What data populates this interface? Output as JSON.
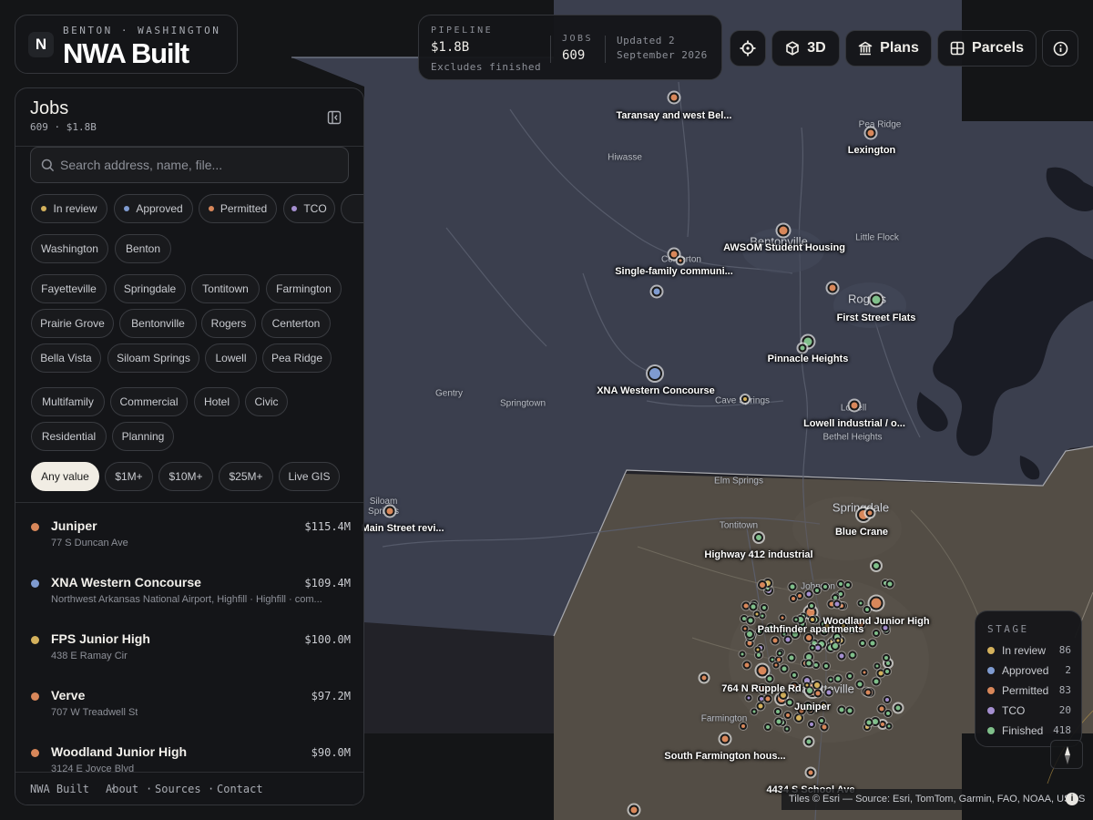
{
  "brand": {
    "logo_letter": "N",
    "location": "BENTON · WASHINGTON",
    "name": "NWA Built"
  },
  "pipeline": {
    "pipeline_label": "PIPELINE",
    "pipeline_value": "$1.8B",
    "pipeline_sub": "Excludes finished",
    "jobs_label": "JOBS",
    "jobs_value": "609",
    "updated_line1": "Updated 2",
    "updated_line2": "September 2026"
  },
  "toolbar": {
    "locate_icon": "crosshair-icon",
    "view3d_label": "3D",
    "view3d_icon": "cube-icon",
    "plans_label": "Plans",
    "plans_icon": "building-columns-icon",
    "parcels_label": "Parcels",
    "parcels_icon": "grid-icon",
    "info_icon": "info-icon"
  },
  "sidebar": {
    "title": "Jobs",
    "stats": "609 · $1.8B",
    "search_placeholder": "Search address, name, file...",
    "stage_filters": [
      {
        "label": "In review",
        "color": "#d4b15c"
      },
      {
        "label": "Approved",
        "color": "#7f9bd0"
      },
      {
        "label": "Permitted",
        "color": "#d8875a"
      },
      {
        "label": "TCO",
        "color": "#a58fd0"
      }
    ],
    "county_filters": [
      "Washington",
      "Benton"
    ],
    "city_filters": [
      "Fayetteville",
      "Springdale",
      "Tontitown",
      "Farmington",
      "Prairie Grove",
      "Bentonville",
      "Rogers",
      "Centerton",
      "Bella Vista",
      "Siloam Springs",
      "Lowell",
      "Pea Ridge"
    ],
    "type_filters": [
      "Multifamily",
      "Commercial",
      "Hotel",
      "Civic",
      "Residential",
      "Planning"
    ],
    "value_filters": [
      "Any value",
      "$1M+",
      "$10M+",
      "$25M+",
      "Live GIS"
    ],
    "jobs": [
      {
        "name": "Juniper",
        "value": "$115.4M",
        "address": "77 S Duncan Ave",
        "color": "#d8875a"
      },
      {
        "name": "XNA Western Concourse",
        "value": "$109.4M",
        "address": "Northwest Arkansas National Airport, Highfill · Highfill · com...",
        "color": "#7f9bd0"
      },
      {
        "name": "FPS Junior High",
        "value": "$100.0M",
        "address": "438 E Ramay Cir",
        "color": "#d4b15c"
      },
      {
        "name": "Verve",
        "value": "$97.2M",
        "address": "707 W Treadwell St",
        "color": "#d8875a"
      },
      {
        "name": "Woodland Junior High",
        "value": "$90.0M",
        "address": "3124 E Joyce Blvd",
        "color": "#d8875a"
      }
    ],
    "footer": [
      "NWA Built",
      "About",
      "Sources",
      "Contact"
    ]
  },
  "legend": {
    "title": "STAGE",
    "items": [
      {
        "label": "In review",
        "count": "86",
        "color": "#d4b15c"
      },
      {
        "label": "Approved",
        "count": "2",
        "color": "#7f9bd0"
      },
      {
        "label": "Permitted",
        "count": "83",
        "color": "#d8875a"
      },
      {
        "label": "TCO",
        "count": "20",
        "color": "#a58fd0"
      },
      {
        "label": "Finished",
        "count": "418",
        "color": "#7fbf8a"
      }
    ]
  },
  "map": {
    "places": [
      "Hiwasse",
      "Pea Ridge",
      "Bentonville",
      "Centerton",
      "Little Flock",
      "Rogers",
      "Gentry",
      "Springtown",
      "Cave Springs",
      "Lowell",
      "Bethel Heights",
      "Elm Springs",
      "Springdale",
      "Siloam Springs",
      "Tontitown",
      "Johnson",
      "Fayetteville",
      "Farmington"
    ],
    "labels": [
      "Taransay and west Bel...",
      "Lexington",
      "AWSOM Student Housing",
      "Single-family communi...",
      "First Street Flats",
      "Pinnacle Heights",
      "XNA Western Concourse",
      "Lowell industrial / o...",
      "Blue Crane",
      "Main Street revi...",
      "Highway 412 industrial",
      "Woodland Junior High",
      "Pathfinder apartments",
      "764 N Rupple Rd",
      "Juniper",
      "South Farmington hous...",
      "4434 S School Ave"
    ],
    "attribution": "Tiles © Esri — Source: Esri, TomTom, Garmin, FAO, NOAA, USGS"
  }
}
